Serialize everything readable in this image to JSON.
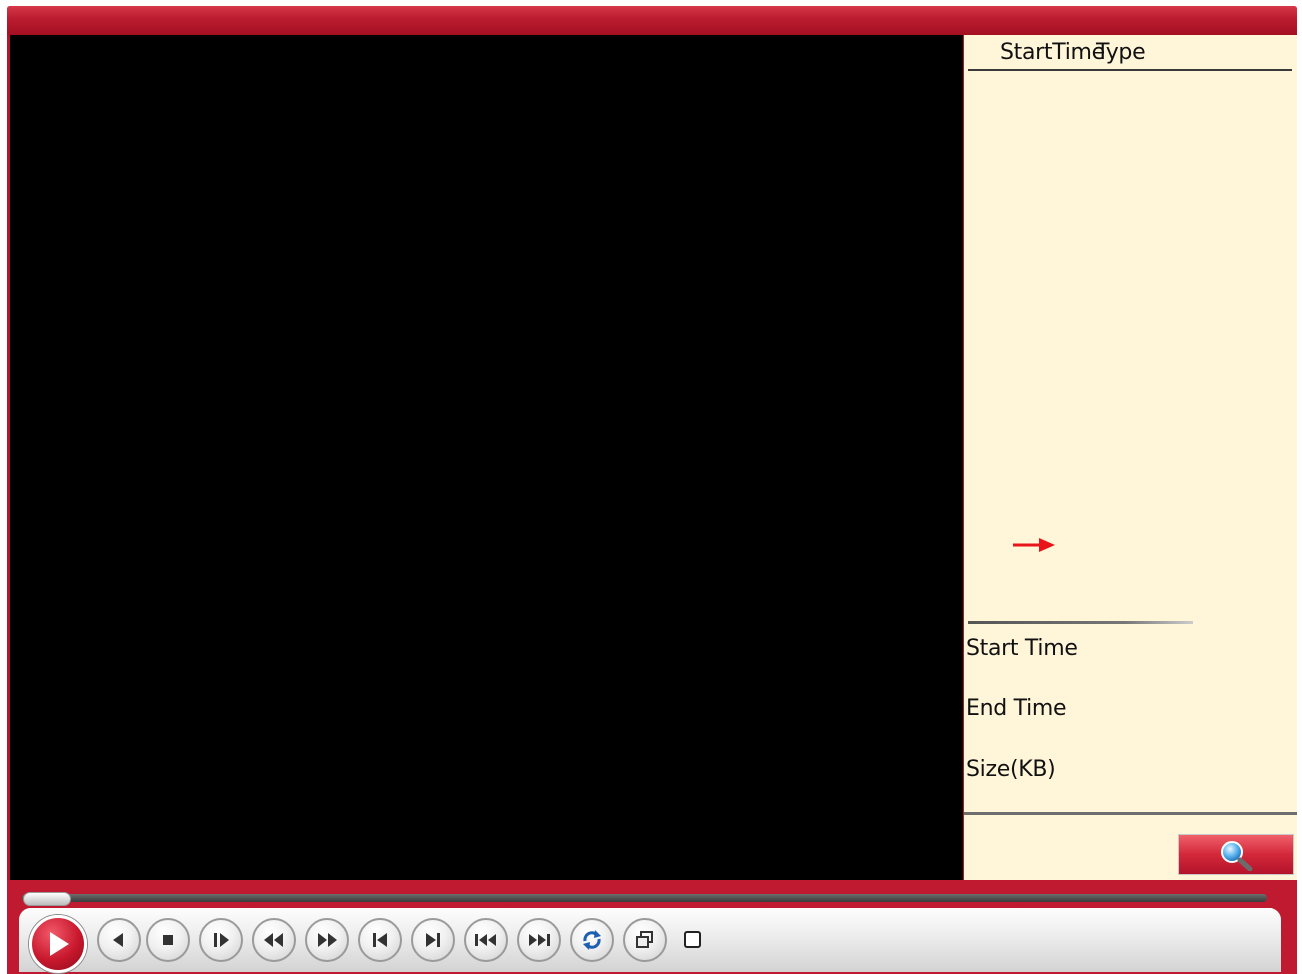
{
  "colors": {
    "frame_red": "#b5152b",
    "panel_bg": "#fff5d9",
    "video_bg": "#000000",
    "cursor_arrow": "#e8141a"
  },
  "file_list": {
    "header": {
      "start_time": "StartTime",
      "type": "Type"
    },
    "rows": []
  },
  "file_info": {
    "start_time_label": "Start Time",
    "end_time_label": "End Time",
    "size_label": "Size(KB)"
  },
  "search_button": {
    "icon": "magnifier-icon"
  },
  "playback": {
    "progress": 0,
    "buttons": [
      {
        "name": "play-button",
        "icon": "play-icon"
      },
      {
        "name": "reverse-play-button",
        "icon": "reverse-play-icon"
      },
      {
        "name": "stop-button",
        "icon": "stop-icon"
      },
      {
        "name": "frame-step-button",
        "icon": "frame-step-icon"
      },
      {
        "name": "slow-button",
        "icon": "rewind-icon"
      },
      {
        "name": "fast-button",
        "icon": "fast-forward-icon"
      },
      {
        "name": "previous-frame-button",
        "icon": "previous-frame-icon"
      },
      {
        "name": "next-frame-button",
        "icon": "next-frame-icon"
      },
      {
        "name": "previous-file-button",
        "icon": "previous-file-icon"
      },
      {
        "name": "next-file-button",
        "icon": "next-file-icon"
      },
      {
        "name": "loop-button",
        "icon": "loop-icon"
      },
      {
        "name": "window-button",
        "icon": "window-icon"
      }
    ],
    "checkbox_checked": false
  }
}
